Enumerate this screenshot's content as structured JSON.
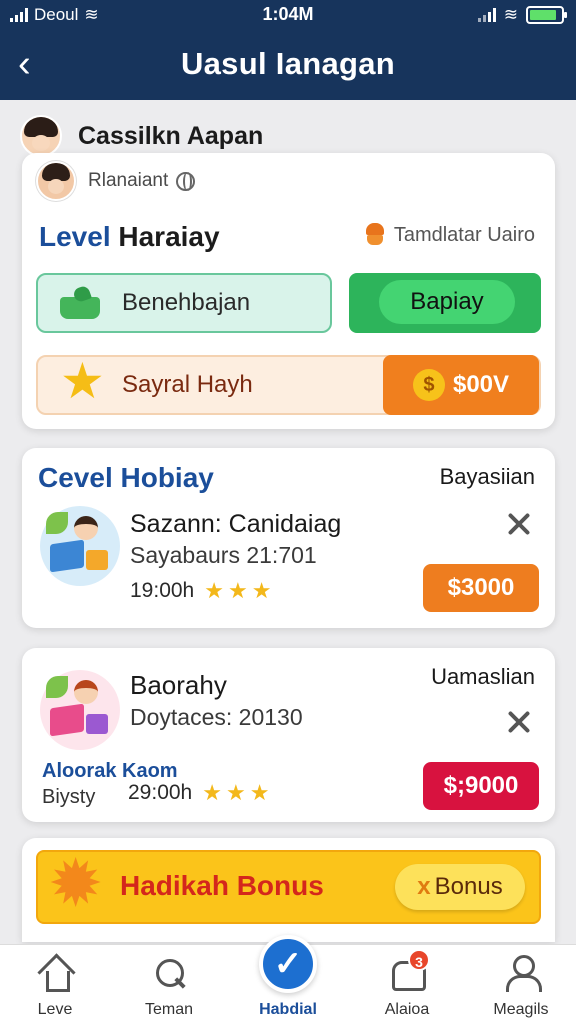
{
  "status_bar": {
    "carrier": "Deoul",
    "time": "1:04M",
    "battery_level": 0.85
  },
  "header": {
    "title": "Uasul Ianagan"
  },
  "user": {
    "name": "Cassilkn Aapan"
  },
  "card_level": {
    "subtitle": "Rlanaiant",
    "title_blue": "Level",
    "title_rest": "Haraiay",
    "tool_label": "Tamdlatar Uairo",
    "benefit_label": "Benehbajan",
    "pay_button": "Bapiay",
    "salary_label": "Sayral Hayh",
    "salary_amount": "$00V"
  },
  "jobs": [
    {
      "section_title": "Cevel Hobiay",
      "right_label": "Bayasiian",
      "name": "Sazann: Canidaiag",
      "detail": "Sayabaurs 21:701",
      "time": "19:00h",
      "stars": [
        "★",
        "★",
        "★"
      ],
      "price": "$3000"
    },
    {
      "right_label": "Uamaslian",
      "name": "Baorahy",
      "detail": "Doytaces: 20130",
      "company": "Aloorak Kaom",
      "company_sub": "Biysty",
      "time": "29:00h",
      "stars": [
        "★",
        "★",
        "★"
      ],
      "price": "$;9000"
    }
  ],
  "bonus": {
    "title": "Hadikah Bonus",
    "button_mark": "x",
    "button_label": "Bonus"
  },
  "nav": {
    "items": [
      {
        "label": "Leve",
        "icon": "home-icon"
      },
      {
        "label": "Teman",
        "icon": "search-icon"
      },
      {
        "label": "Habdial",
        "icon": "check-icon"
      },
      {
        "label": "Alaioa",
        "icon": "bell-icon",
        "badge": "3"
      },
      {
        "label": "Meagils",
        "icon": "user-icon"
      }
    ]
  },
  "colors": {
    "header_bg": "#17345c",
    "accent_blue": "#1b4e9a",
    "green": "#2db45b",
    "orange": "#ee7d1f",
    "red": "#d8123f",
    "bonus_yellow": "#fbc41a"
  }
}
